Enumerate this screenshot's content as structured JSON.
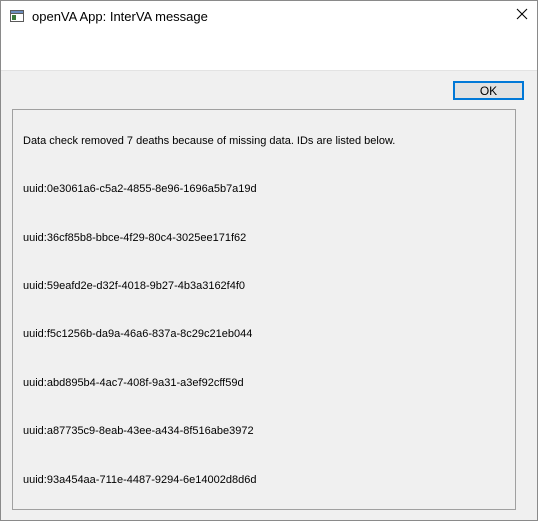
{
  "window": {
    "title": "openVA App: InterVA message"
  },
  "toolbar": {
    "ok_label": "OK"
  },
  "message": {
    "header": "Data check removed 7 deaths because of missing data.  IDs are listed below.",
    "ids": [
      "uuid:0e3061a6-c5a2-4855-8e96-1696a5b7a19d",
      "uuid:36cf85b8-bbce-4f29-80c4-3025ee171f62",
      "uuid:59eafd2e-d32f-4018-9b27-4b3a3162f4f0",
      "uuid:f5c1256b-da9a-46a6-837a-8c29c21eb044",
      "uuid:abd895b4-4ac7-408f-9a31-a3ef92cff59d",
      "uuid:a87735c9-8eab-43ee-a434-8f516abe3972",
      "uuid:93a454aa-711e-4487-9294-6e14002d8d6d"
    ]
  },
  "icons": {
    "app": "window-app-icon",
    "close": "close-icon"
  },
  "colors": {
    "accent": "#0078d7",
    "dialog_bg": "#f0f0f0",
    "titlebar_bg": "#ffffff"
  }
}
